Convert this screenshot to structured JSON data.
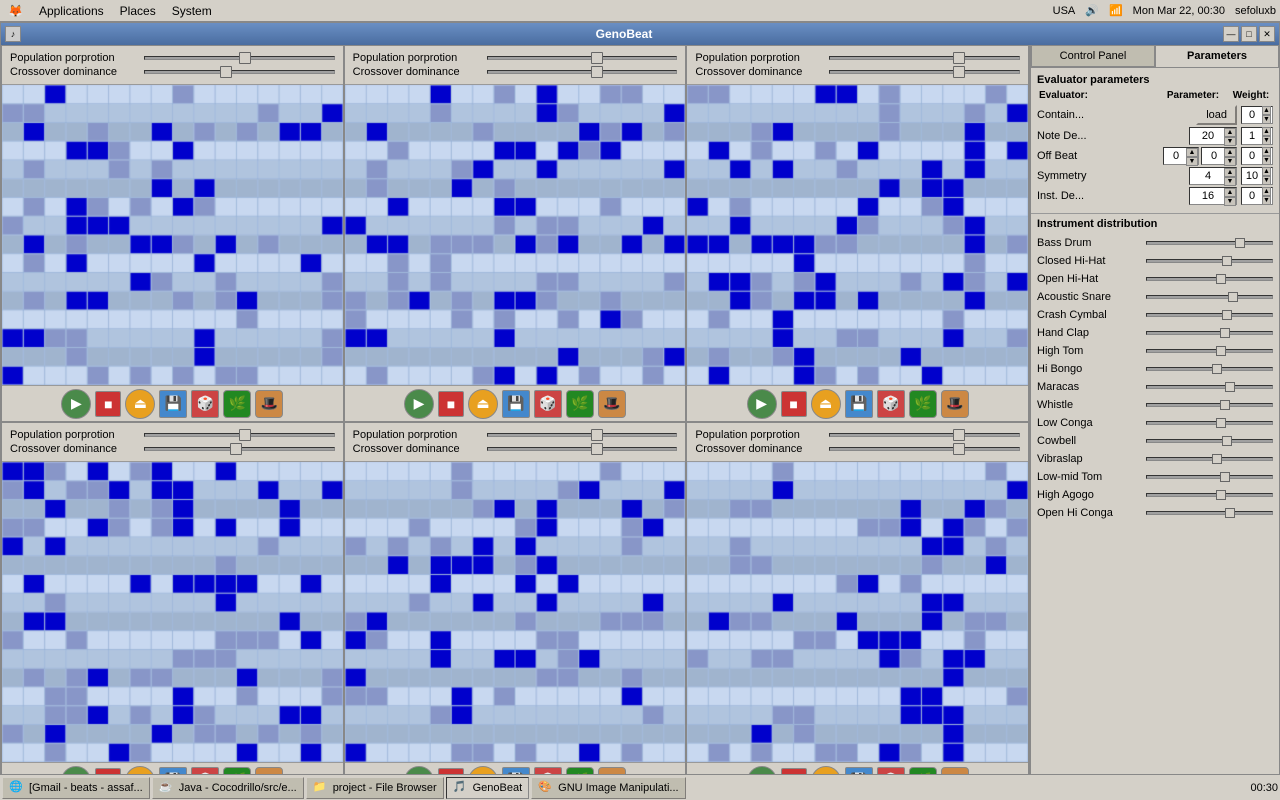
{
  "topbar": {
    "app_menu": [
      "Applications",
      "Places",
      "System"
    ],
    "locale": "USA",
    "datetime": "Mon Mar 22, 00:30",
    "user": "sefoluxb"
  },
  "window": {
    "title": "GenoBeat",
    "min_label": "—",
    "max_label": "□",
    "close_label": "✕"
  },
  "panels": [
    {
      "id": "panel-1",
      "pop_label": "Population porprotion",
      "cross_label": "Crossover dominance",
      "pop_thumb": 55,
      "cross_thumb": 40
    },
    {
      "id": "panel-2",
      "pop_label": "Population porprotion",
      "cross_label": "Crossover dominance",
      "pop_thumb": 55,
      "cross_thumb": 55
    },
    {
      "id": "panel-3",
      "pop_label": "Population porprotion",
      "cross_label": "Crossover dominance",
      "pop_thumb": 65,
      "cross_thumb": 65
    },
    {
      "id": "panel-4",
      "pop_label": "Population porprotion",
      "cross_label": "Crossover dominance",
      "pop_thumb": 50,
      "cross_thumb": 45
    },
    {
      "id": "panel-5",
      "pop_label": "Population porprotion",
      "cross_label": "Crossover dominance",
      "pop_thumb": 55,
      "cross_thumb": 55
    },
    {
      "id": "panel-6",
      "pop_label": "Population porprotion",
      "cross_label": "Crossover dominance",
      "pop_thumb": 65,
      "cross_thumb": 65
    }
  ],
  "right_panel": {
    "tab1": "Control Panel",
    "tab2": "Parameters",
    "section_title": "Evaluator parameters",
    "evaluator_col": "Evaluator:",
    "param_col": "Parameter:",
    "weight_col": "Weight:",
    "evaluators": [
      {
        "name": "Contain...",
        "param_type": "load",
        "param_val": "",
        "weight": "0"
      },
      {
        "name": "Note De...",
        "param_val": "20",
        "weight": "1"
      },
      {
        "name": "Off Beat",
        "param_val1": "0",
        "param_val2": "0",
        "weight": "0"
      },
      {
        "name": "Symmetry",
        "param_val": "4",
        "weight": "10"
      },
      {
        "name": "Inst. De...",
        "param_val": "16",
        "weight": "0"
      }
    ],
    "inst_dist_title": "Instrument distribution",
    "instruments": [
      {
        "name": "Bass Drum",
        "pos": 70
      },
      {
        "name": "Closed Hi-Hat",
        "pos": 60
      },
      {
        "name": "Open Hi-Hat",
        "pos": 55
      },
      {
        "name": "Acoustic Snare",
        "pos": 65
      },
      {
        "name": "Crash Cymbal",
        "pos": 60
      },
      {
        "name": "Hand Clap",
        "pos": 58
      },
      {
        "name": "High Tom",
        "pos": 55
      },
      {
        "name": "Hi Bongo",
        "pos": 52
      },
      {
        "name": "Maracas",
        "pos": 62
      },
      {
        "name": "Whistle",
        "pos": 58
      },
      {
        "name": "Low Conga",
        "pos": 55
      },
      {
        "name": "Cowbell",
        "pos": 60
      },
      {
        "name": "Vibraslap",
        "pos": 52
      },
      {
        "name": "Low-mid Tom",
        "pos": 58
      },
      {
        "name": "High Agogo",
        "pos": 55
      },
      {
        "name": "Open Hi Conga",
        "pos": 62
      }
    ]
  },
  "taskbar": {
    "items": [
      {
        "icon": "🌐",
        "label": "[Gmail - beats - assaf..."
      },
      {
        "icon": "☕",
        "label": "Java - Cocodrillo/src/e..."
      },
      {
        "icon": "📁",
        "label": "project - File Browser"
      },
      {
        "icon": "🎵",
        "label": "GenoBeat",
        "active": true
      },
      {
        "icon": "🎨",
        "label": "GNU Image Manipulati..."
      }
    ]
  }
}
